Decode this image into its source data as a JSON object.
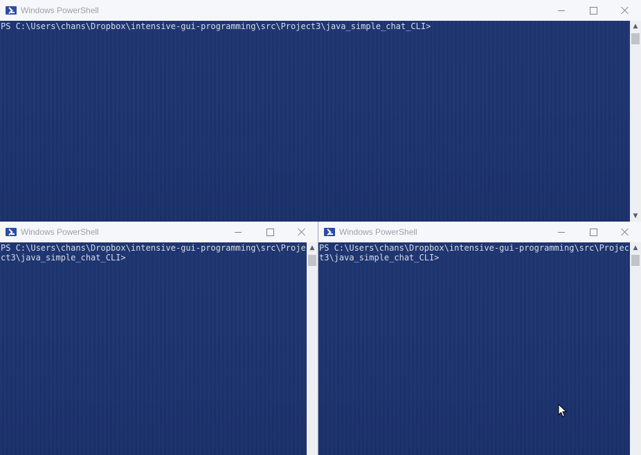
{
  "windows": [
    {
      "title": "Windows PowerShell",
      "console_text": "PS C:\\Users\\chans\\Dropbox\\intensive-gui-programming\\src\\Project3\\java_simple_chat_CLI>"
    },
    {
      "title": "Windows PowerShell",
      "console_text": "PS C:\\Users\\chans\\Dropbox\\intensive-gui-programming\\src\\Project3\\java_simple_chat_CLI>"
    },
    {
      "title": "Windows PowerShell",
      "console_text": "PS C:\\Users\\chans\\Dropbox\\intensive-gui-programming\\src\\Project3\\java_simple_chat_CLI>"
    }
  ],
  "icons": {
    "app": "powershell-icon",
    "minimize": "minimize-icon",
    "maximize": "maximize-icon",
    "close": "close-icon",
    "scroll_up": "scroll-up-arrow-icon",
    "scroll_down": "scroll-down-arrow-icon",
    "cursor": "mouse-pointer-icon"
  },
  "colors": {
    "console_bg": "#1d3470",
    "console_text": "#d7dce8",
    "titlebar_bg": "#f6f7fa"
  }
}
